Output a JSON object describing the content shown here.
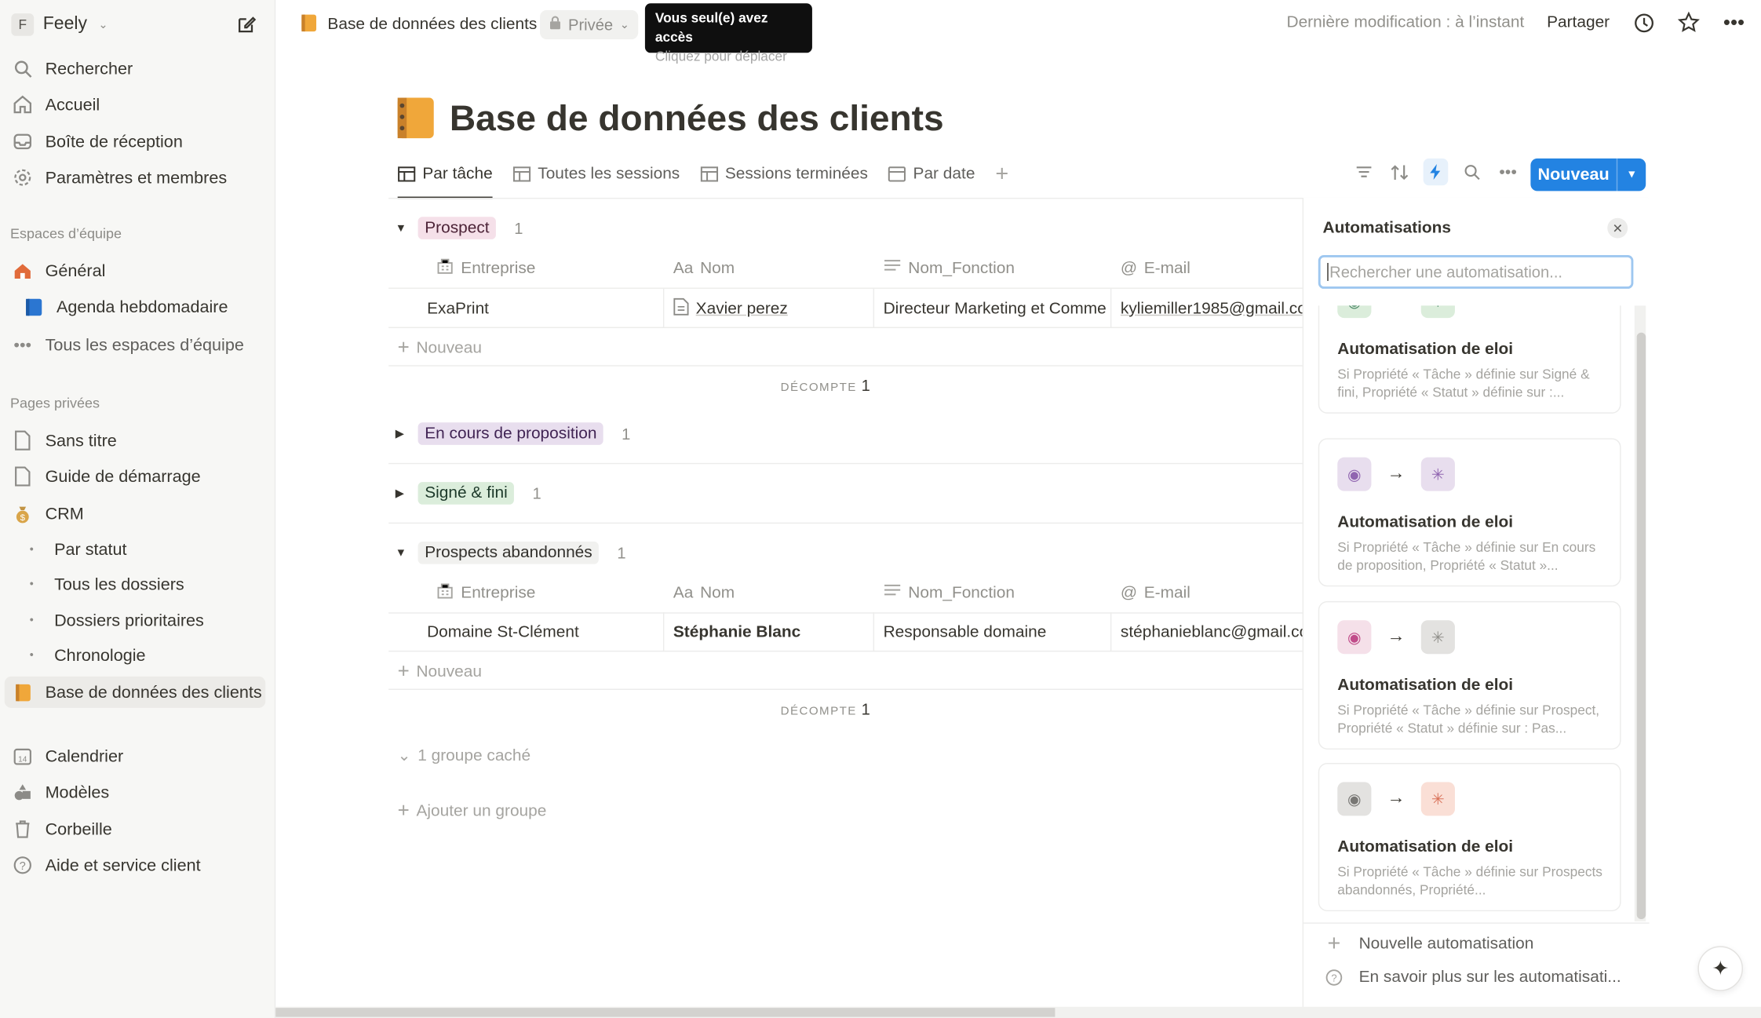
{
  "sidebar": {
    "workspace_badge": "F",
    "workspace_name": "Feely",
    "nav": [
      {
        "label": "Rechercher",
        "icon": "search-icon"
      },
      {
        "label": "Accueil",
        "icon": "home-icon"
      },
      {
        "label": "Boîte de réception",
        "icon": "inbox-icon"
      },
      {
        "label": "Paramètres et membres",
        "icon": "gear-icon"
      }
    ],
    "team_section": "Espaces d’équipe",
    "team_items": [
      {
        "label": "Général",
        "icon": "house-icon"
      },
      {
        "label": "Agenda hebdomadaire",
        "icon": "blue-book-icon"
      },
      {
        "label": "Tous les espaces d’équipe",
        "icon": "ellipsis-icon"
      }
    ],
    "private_section": "Pages privées",
    "private_items": [
      {
        "label": "Sans titre",
        "icon": "page-icon"
      },
      {
        "label": "Guide de démarrage",
        "icon": "page-icon"
      },
      {
        "label": "CRM",
        "icon": "money-bag-icon"
      },
      {
        "label": "Par statut",
        "icon": "bullet-icon"
      },
      {
        "label": "Tous les dossiers",
        "icon": "bullet-icon"
      },
      {
        "label": "Dossiers prioritaires",
        "icon": "bullet-icon"
      },
      {
        "label": "Chronologie",
        "icon": "bullet-icon"
      },
      {
        "label": "Base de données des clients",
        "icon": "notebook-icon"
      }
    ],
    "bottom_items": [
      {
        "label": "Calendrier",
        "icon": "calendar-icon"
      },
      {
        "label": "Modèles",
        "icon": "shapes-icon"
      },
      {
        "label": "Corbeille",
        "icon": "trash-icon"
      },
      {
        "label": "Aide et service client",
        "icon": "help-icon"
      }
    ]
  },
  "topbar": {
    "breadcrumb": "Base de données des clients",
    "privacy": "Privée",
    "tooltip_line1": "Vous seul(e) avez accès",
    "tooltip_line2": "Cliquez pour déplacer",
    "last_modified": "Dernière modification : à l’instant",
    "share": "Partager"
  },
  "page": {
    "title": "Base de données des clients",
    "tabs": [
      "Par tâche",
      "Toutes les sessions",
      "Sessions terminées",
      "Par date"
    ],
    "new_button": "Nouveau"
  },
  "db": {
    "columns": [
      "Entreprise",
      "Nom",
      "Nom_Fonction",
      "E-mail"
    ],
    "col_prefix_name": "Aa",
    "groups": [
      {
        "label": "Prospect",
        "count": "1",
        "color": "#f5e0e9",
        "text_color": "#4c2337"
      },
      {
        "label": "En cours de proposition",
        "count": "1",
        "color": "#e8deee",
        "text_color": "#412454"
      },
      {
        "label": "Signé & fini",
        "count": "1",
        "color": "#dbeddb",
        "text_color": "#1c3829"
      },
      {
        "label": "Prospects abandonnés",
        "count": "1",
        "color": "#f1f1ef",
        "text_color": "#32302c"
      }
    ],
    "row1": {
      "entreprise": "ExaPrint",
      "nom": "Xavier perez",
      "fonction": "Directeur Marketing et Comme",
      "email": "kyliemiller1985@gmail.co"
    },
    "row2": {
      "entreprise": "Domaine St-Clément",
      "nom": "Stéphanie Blanc",
      "fonction": "Responsable domaine",
      "email": "stéphanieblanc@gmail.co"
    },
    "new_row": "Nouveau",
    "count_label": "DÉCOMPTE",
    "count_value": "1",
    "hidden_groups": "1 groupe caché",
    "add_group": "Ajouter un groupe"
  },
  "automations": {
    "title": "Automatisations",
    "search_placeholder": "Rechercher une automatisation...",
    "cards": [
      {
        "title": "Automatisation de eloi",
        "desc": "Si Propriété « Tâche » définie sur Signé & fini, Propriété « Statut » définie sur :...",
        "trigger_bg": "#dbeddb",
        "trigger_color": "#448361",
        "action_bg": "#dbeddb",
        "action_color": "#448361"
      },
      {
        "title": "Automatisation de eloi",
        "desc": "Si Propriété « Tâche » définie sur En cours de proposition, Propriété « Statut »...",
        "trigger_bg": "#e8deee",
        "trigger_color": "#9065b0",
        "action_bg": "#e8deee",
        "action_color": "#9065b0"
      },
      {
        "title": "Automatisation de eloi",
        "desc": "Si Propriété « Tâche » définie sur Prospect, Propriété « Statut » définie sur : Pas...",
        "trigger_bg": "#f5e0e9",
        "trigger_color": "#c14c8a",
        "action_bg": "#e3e2e0",
        "action_color": "#91908b"
      },
      {
        "title": "Automatisation de eloi",
        "desc": "Si Propriété « Tâche » définie sur Prospects abandonnés, Propriété...",
        "trigger_bg": "#e3e2e0",
        "trigger_color": "#787774",
        "action_bg": "#fadfd6",
        "action_color": "#d9735b"
      }
    ],
    "new_automation": "Nouvelle automatisation",
    "learn_more": "En savoir plus sur les automatisati..."
  }
}
